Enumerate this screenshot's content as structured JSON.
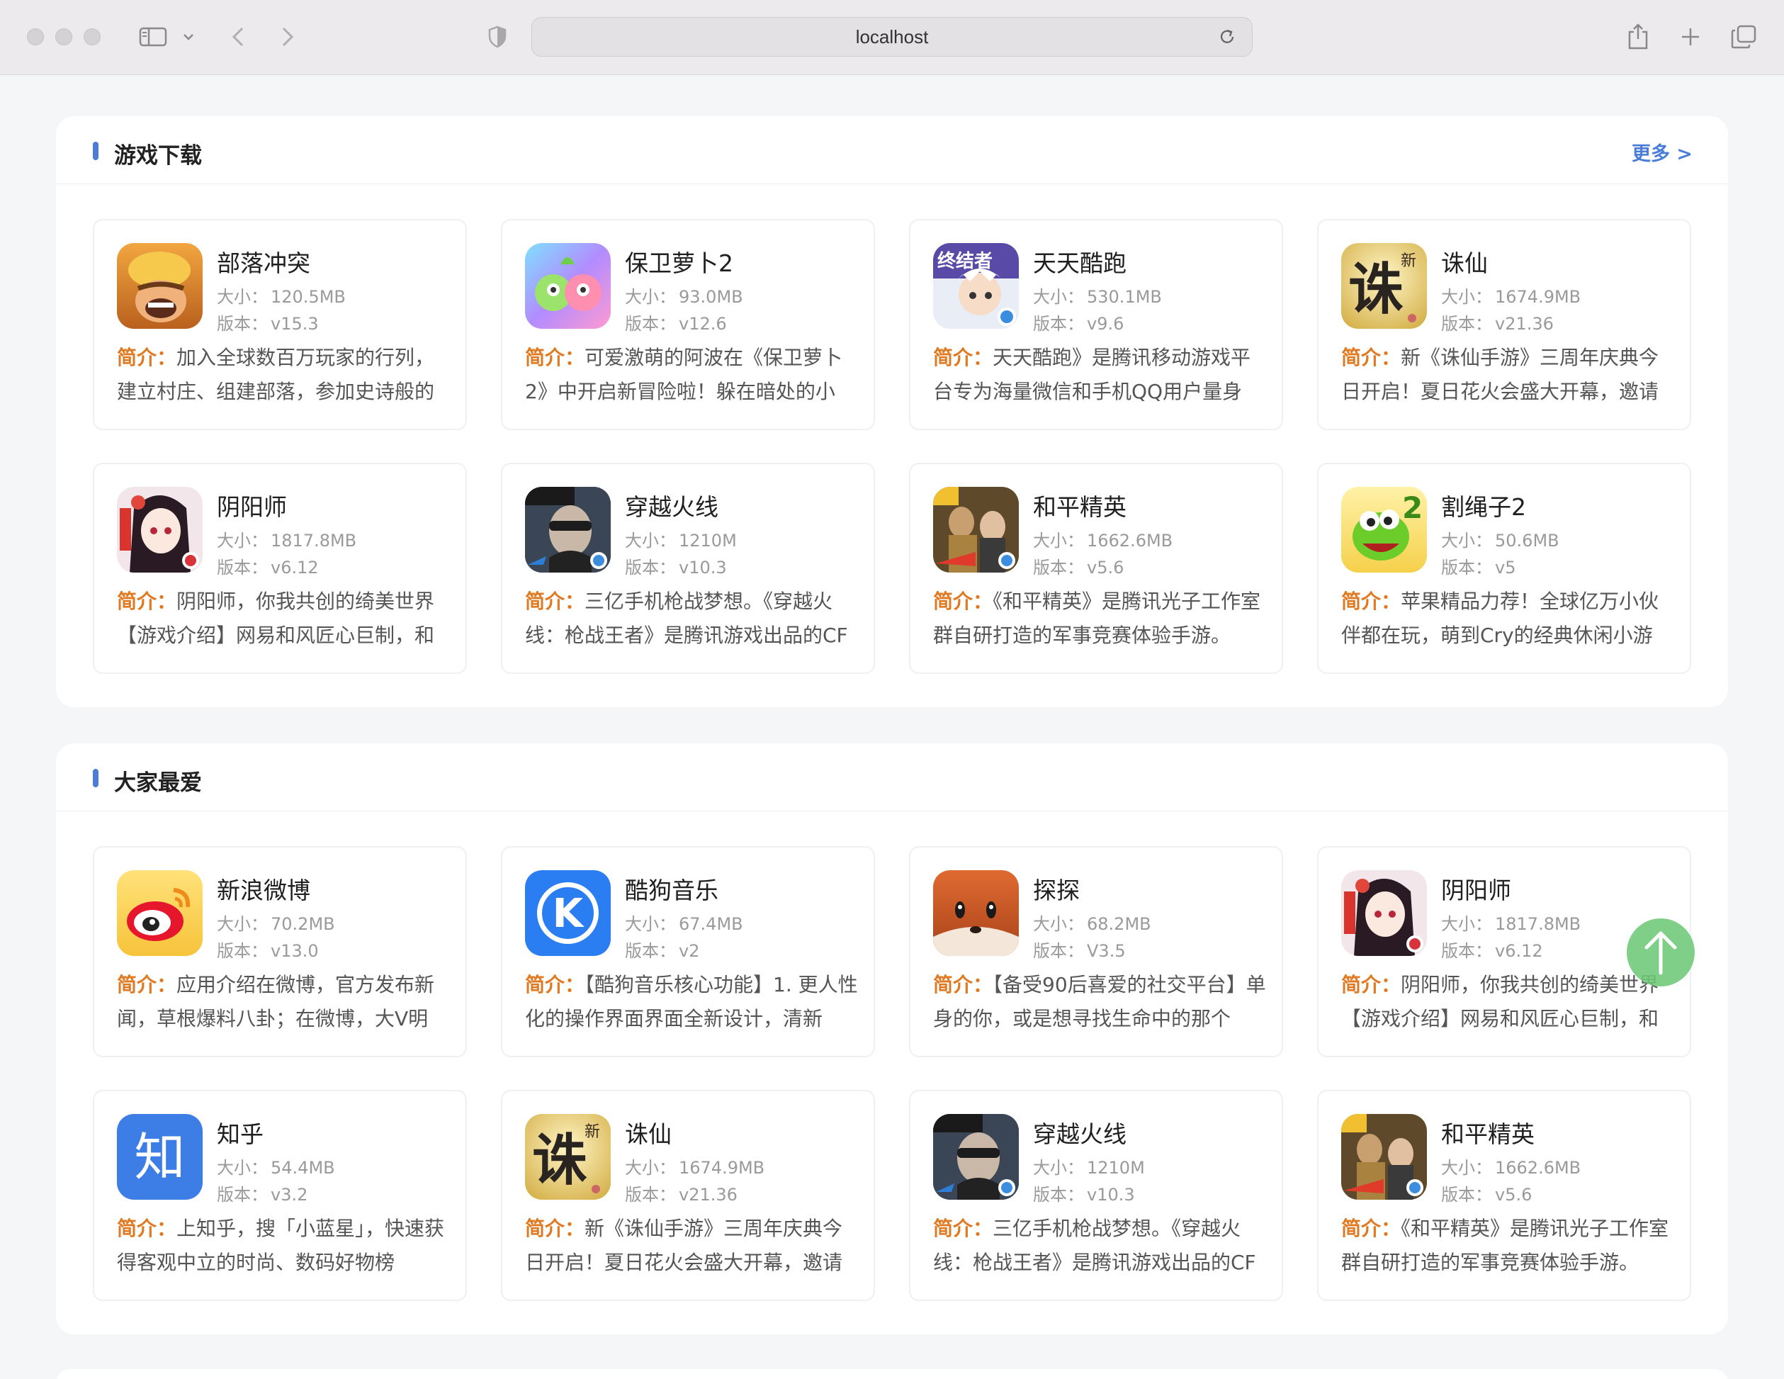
{
  "browser": {
    "url": "localhost"
  },
  "sections": [
    {
      "title": "游戏下载",
      "more": "更多 >",
      "apps": [
        {
          "name": "部落冲突",
          "size": "120.5MB",
          "version": "v15.3",
          "desc": "加入全球数百万玩家的行列，建立村庄、组建部落，参加史诗般的",
          "icon": "coc-icon"
        },
        {
          "name": "保卫萝卜2",
          "size": "93.0MB",
          "version": "v12.6",
          "desc": "可爱激萌的阿波在《保卫萝卜2》中开启新冒险啦！躲在暗处的小",
          "icon": "carrot-icon"
        },
        {
          "name": "天天酷跑",
          "size": "530.1MB",
          "version": "v9.6",
          "desc": "天天酷跑》是腾讯移动游戏平台专为海量微信和手机QQ用户量身",
          "icon": "parkour-icon"
        },
        {
          "name": "诛仙",
          "size": "1674.9MB",
          "version": "v21.36",
          "desc": "新《诛仙手游》三周年庆典今日开启！夏日花火会盛大开幕，邀请",
          "icon": "zhuxian-icon"
        },
        {
          "name": "阴阳师",
          "size": "1817.8MB",
          "version": "v6.12",
          "desc": "阴阳师，你我共创的绮美世界【游戏介绍】网易和风匠心巨制，和",
          "icon": "onmyoji-icon"
        },
        {
          "name": "穿越火线",
          "size": "1210M",
          "version": "v10.3",
          "desc": "三亿手机枪战梦想。《穿越火线：枪战王者》是腾讯游戏出品的CF",
          "icon": "crossfire-icon"
        },
        {
          "name": "和平精英",
          "size": "1662.6MB",
          "version": "v5.6",
          "desc": "《和平精英》是腾讯光子工作室群自研打造的军事竞赛体验手游。",
          "icon": "peace-elite-icon"
        },
        {
          "name": "割绳子2",
          "size": "50.6MB",
          "version": "v5",
          "desc": "苹果精品力荐！全球亿万小伙伴都在玩，萌到Cry的经典休闲小游",
          "icon": "cut-rope-icon"
        }
      ]
    },
    {
      "title": "大家最爱",
      "apps": [
        {
          "name": "新浪微博",
          "size": "70.2MB",
          "version": "v13.0",
          "desc": "应用介绍在微博，官方发布新闻，草根爆料八卦；在微博，大V明",
          "icon": "weibo-icon"
        },
        {
          "name": "酷狗音乐",
          "size": "67.4MB",
          "version": "v2",
          "desc": "【酷狗音乐核心功能】1. 更人性化的操作界面界面全新设计，清新",
          "icon": "kugou-icon"
        },
        {
          "name": "探探",
          "size": "68.2MB",
          "version": "V3.5",
          "desc": "【备受90后喜爱的社交平台】单身的你，或是想寻找生命中的那个",
          "icon": "tantan-icon"
        },
        {
          "name": "阴阳师",
          "size": "1817.8MB",
          "version": "v6.12",
          "desc": "阴阳师，你我共创的绮美世界【游戏介绍】网易和风匠心巨制，和",
          "icon": "onmyoji-icon"
        },
        {
          "name": "知乎",
          "size": "54.4MB",
          "version": "v3.2",
          "desc": "上知乎，搜「小蓝星」，快速获得客观中立的时尚、数码好物榜",
          "icon": "zhihu-icon"
        },
        {
          "name": "诛仙",
          "size": "1674.9MB",
          "version": "v21.36",
          "desc": "新《诛仙手游》三周年庆典今日开启！夏日花火会盛大开幕，邀请",
          "icon": "zhuxian-icon"
        },
        {
          "name": "穿越火线",
          "size": "1210M",
          "version": "v10.3",
          "desc": "三亿手机枪战梦想。《穿越火线：枪战王者》是腾讯游戏出品的CF",
          "icon": "crossfire-icon"
        },
        {
          "name": "和平精英",
          "size": "1662.6MB",
          "version": "v5.6",
          "desc": "《和平精英》是腾讯光子工作室群自研打造的军事竞赛体验手游。",
          "icon": "peace-elite-icon"
        }
      ]
    }
  ],
  "labels": {
    "size": "大小：",
    "version": "版本：",
    "desc": "简介："
  },
  "icon_text": {
    "zhihu": "知",
    "kugou": "K",
    "zhuxian": "诛",
    "zhuxian_small": "新",
    "cut_rope": "2",
    "parkour": "终结者"
  },
  "colors": {
    "accent": "#4a7cd8",
    "desc_label": "#e07a22",
    "back_to_top": "#6ec878"
  }
}
